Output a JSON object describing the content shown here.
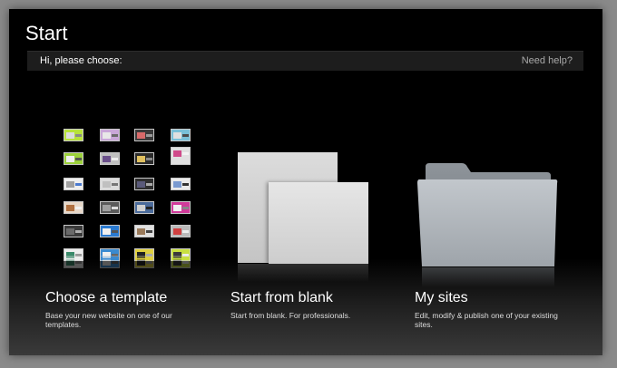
{
  "window": {
    "title": "Start"
  },
  "header": {
    "greeting": "Hi, please choose:",
    "help_link": "Need help?"
  },
  "options": [
    {
      "title": "Choose a template",
      "description": "Base your new website on one of our templates."
    },
    {
      "title": "Start from blank",
      "description": "Start from blank. For professionals."
    },
    {
      "title": "My sites",
      "description": "Edit, modify & publish one of your existing sites."
    }
  ],
  "colors": {
    "background": "#000000",
    "header_bar": "#1d1d1d",
    "text": "#ffffff",
    "muted_text": "#a9a9a9",
    "page": "#d4d4d4",
    "folder": "#a9aeb3"
  },
  "icons": {
    "template": "template-grid-icon",
    "blank": "blank-pages-icon",
    "sites": "folder-icon"
  }
}
